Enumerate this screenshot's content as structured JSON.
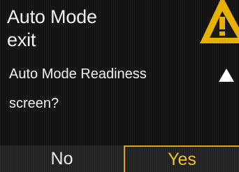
{
  "dialog": {
    "title_lines": [
      "Auto Mode",
      "exit"
    ],
    "question_lines": [
      "Auto Mode Readiness",
      "screen?"
    ]
  },
  "icons": {
    "warning": "warning-triangle-icon",
    "scroll": "scroll-up-arrow-icon"
  },
  "buttons": {
    "no_label": "No",
    "yes_label": "Yes"
  },
  "colors": {
    "background": "#0f0f0f",
    "text": "#f2f2f2",
    "accent": "#f2c12e",
    "warning": "#e7b100"
  }
}
